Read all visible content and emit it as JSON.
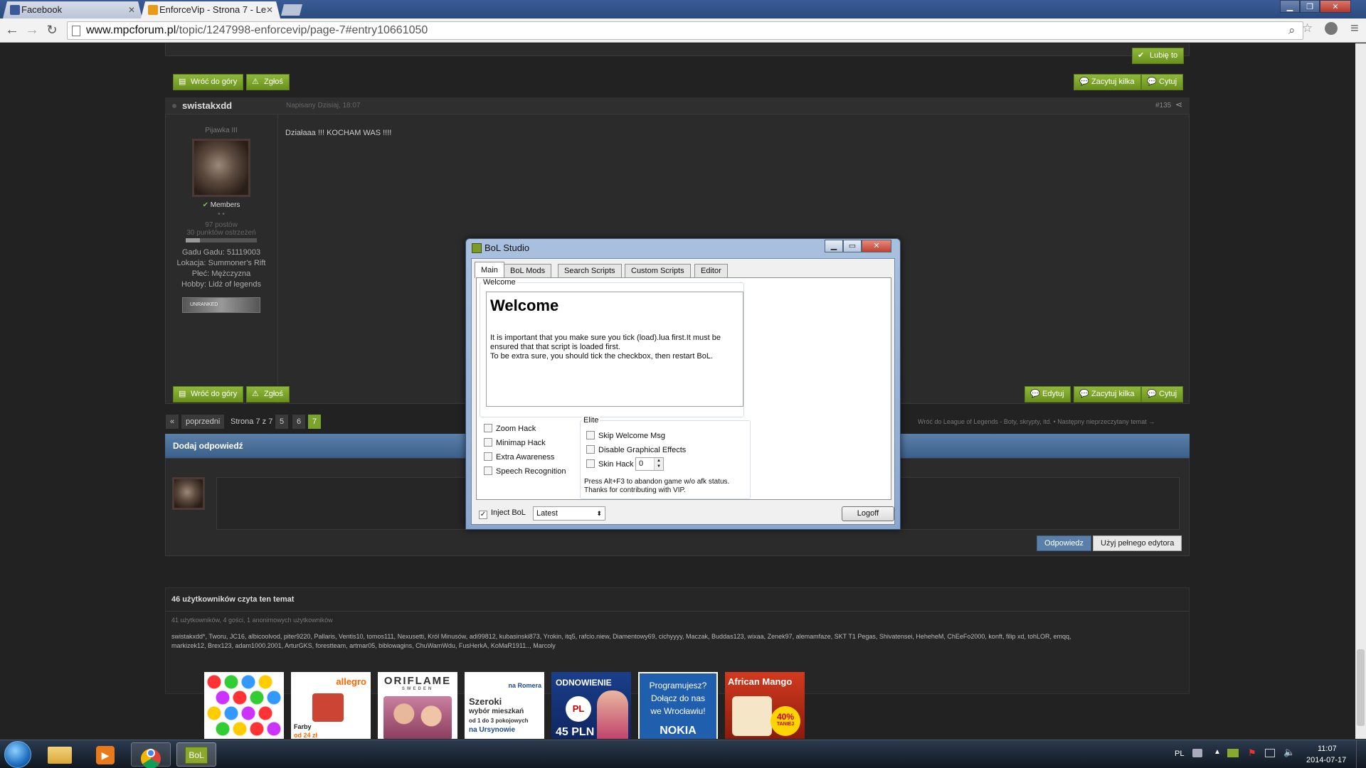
{
  "browser": {
    "tabs": [
      {
        "label": "Facebook"
      },
      {
        "label": "EnforceVip - Strona 7 - Le"
      }
    ],
    "url_host": "www.mpcforum.pl",
    "url_path": "/topic/1247998-enforcevip/page-7#entry10661050"
  },
  "forum": {
    "like_label": "Lubię to",
    "back_to_top": "Wróć do góry",
    "report": "Zgłoś",
    "quote_multi": "Zacytuj kilka",
    "quote": "Cytuj",
    "edit": "Edytuj",
    "post": {
      "author": "swistakxdd",
      "date": "Napisany Dzisiaj, 18:07",
      "number": "#135",
      "body": "Działaaa !!! KOCHAM WAS !!!!",
      "rank": "Pijawka III",
      "group": "Members",
      "posts": "97 postów",
      "warnings": "30 punktów ostrzeżeń",
      "gadu": "Gadu Gadu: 51119003",
      "location": "Lokacja: Summoner's Rift",
      "gender": "Płeć: Mężczyzna",
      "hobby": "Hobby: Lidż of legends",
      "badge": "UNRANKED"
    },
    "pagination": {
      "first": "«",
      "prev": "poprzedni",
      "current": "Strona 7 z 7",
      "pages": [
        "5",
        "6",
        "7"
      ]
    },
    "breadcrumb_next": "Wróć do League of Legends - Boty, skrypty, itd. • Następny nieprzeczytany temat →",
    "reply_header": "Dodaj odpowiedź",
    "reply_btn": "Odpowiedz",
    "full_editor_btn": "Użyj pełnego edytora",
    "online_title": "46 użytkowników czyta ten temat",
    "online_summary": "41 użytkowników, 4 gości, 1 anonimowych użytkowników",
    "online_line1": "swistakxdd*, Tworu, JC16, albicoolvod, piter9220, Pallaris, Ventis10, tomos111, Nexusetti, Król Minusów, adi99812, kubasinski873, Yrokin, itq5, rafcio.niew, Diamentowy69, cichyyyy, Maczak, Buddas123, wixaa, Zenek97, alemamfaze, SKT T1 Pegas, Shivatensei, HeheheM, ChEeFo2000, konft, filip xd, tohLOR, emqq,",
    "online_line2": "markizek12, Brex123, adam1000.2001, ArturGKS, forestteam, artmar05, biblowagins, ChuWamWdu, FusHerkA, KoMaR1911.., Marcoly"
  },
  "ads": [
    {
      "text": ""
    },
    {
      "text": "allegro",
      "sub": "Farby",
      "sub2": "od 24 zł"
    },
    {
      "text": "ORIFLAME",
      "sub": "SWEDEN"
    },
    {
      "text": "Szeroki",
      "sub": "wybór mieszkań",
      "sub2": "od 1 do 3 pokojowych",
      "sub3": "na Ursynowie",
      "brand": "na Romera"
    },
    {
      "text": "ODNOWIENIE",
      "sub": "PL",
      "sub2": "45 PLN"
    },
    {
      "text": "Programujesz?",
      "sub": "Dołącz do nas",
      "sub2": "we Wrocławiu!",
      "sub3": "NOKIA"
    },
    {
      "text": "African Mango",
      "sub": "40%",
      "sub2": "TANIEJ"
    }
  ],
  "dialog": {
    "title": "BoL Studio",
    "tabs": [
      "Main",
      "BoL Mods",
      "Search Scripts",
      "Custom Scripts",
      "Editor"
    ],
    "welcome_group": "Welcome",
    "welcome_heading": "Welcome",
    "welcome_text1": "It is important that you make sure you tick (load).lua first.It must be",
    "welcome_text2": "ensured that that script is loaded first.",
    "welcome_text3": "To be extra sure, you should tick the checkbox, then restart BoL.",
    "hacks": [
      "Zoom Hack",
      "Minimap Hack",
      "Extra Awareness",
      "Speech Recognition"
    ],
    "elite_group": "Elite",
    "elite_items": [
      "Skip Welcome Msg",
      "Disable Graphical Effects",
      "Skin Hack"
    ],
    "skin_value": "0",
    "elite_note1": "Press Alt+F3 to abandon game w/o afk status.",
    "elite_note2": "Thanks for contributing with VIP.",
    "inject_label": "Inject BoL",
    "inject_checked": "✓",
    "version": "Latest",
    "logoff": "Logoff"
  },
  "taskbar": {
    "bol_label": "BoL",
    "lang": "PL",
    "time": "11:07",
    "date": "2014-07-17"
  }
}
